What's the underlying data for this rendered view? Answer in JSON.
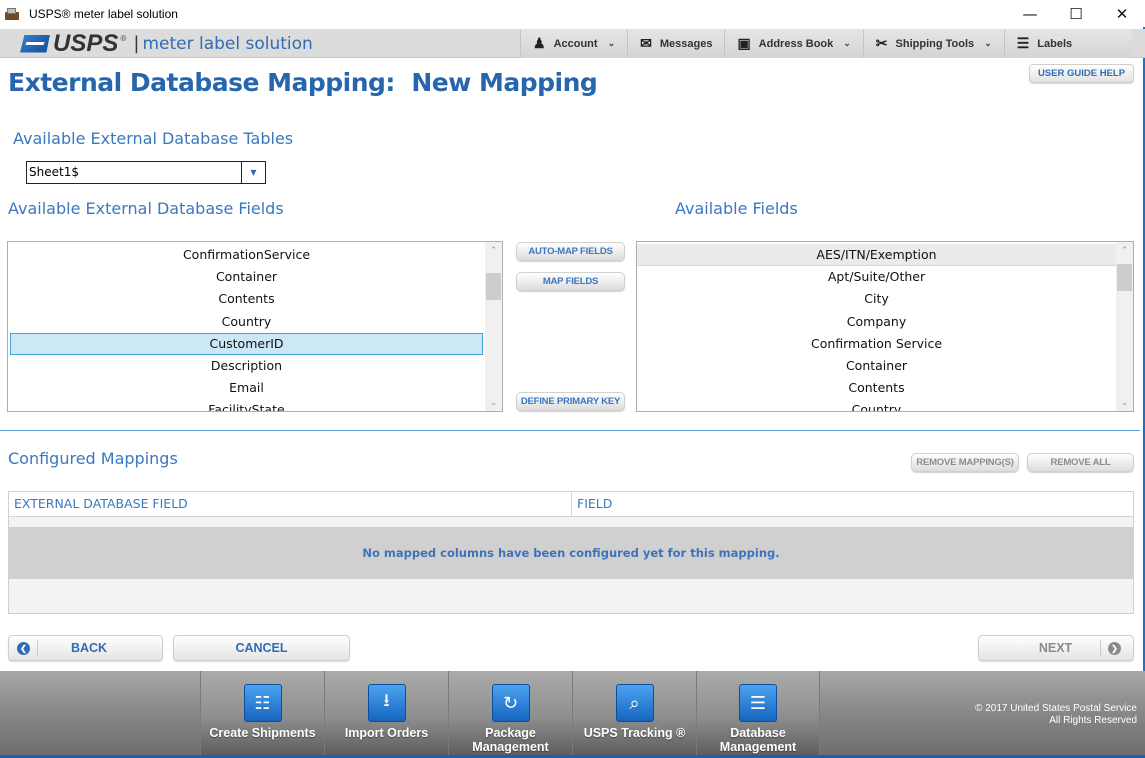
{
  "window": {
    "title": "USPS® meter label solution",
    "controls": {
      "minimize": "—",
      "maximize": "☐",
      "close": "✕"
    }
  },
  "appbar": {
    "brand": "USPS",
    "brand_mark": "®",
    "separator": "|",
    "product": "meter label solution",
    "nav": [
      {
        "label": "Account",
        "icon": "person-icon",
        "glyph": "♟",
        "has_dropdown": true
      },
      {
        "label": "Messages",
        "icon": "envelope-icon",
        "glyph": "✉",
        "has_dropdown": false
      },
      {
        "label": "Address Book",
        "icon": "address-book-icon",
        "glyph": "▣",
        "has_dropdown": true
      },
      {
        "label": "Shipping Tools",
        "icon": "scissors-icon",
        "glyph": "✂",
        "has_dropdown": true
      },
      {
        "label": "Labels",
        "icon": "cart-icon",
        "glyph": "☰",
        "has_dropdown": false
      }
    ],
    "chevron": "⌄"
  },
  "page": {
    "title": "External Database Mapping:  New Mapping",
    "help_button": "USER GUIDE HELP"
  },
  "tables_section": {
    "label": "Available External Database Tables",
    "selected_table": "Sheet1$",
    "dropdown_arrow": "▼"
  },
  "external_fields": {
    "label": "Available External Database Fields",
    "items": [
      "ConfirmationService",
      "Container",
      "Contents",
      "Country",
      "CustomerID",
      "Description",
      "Email",
      "FacilityState"
    ],
    "selected": "CustomerID"
  },
  "available_fields": {
    "label": "Available Fields",
    "items": [
      "AES/ITN/Exemption",
      "Apt/Suite/Other",
      "City",
      "Company",
      "Confirmation Service",
      "Container",
      "Contents",
      "Country"
    ],
    "highlighted": "AES/ITN/Exemption"
  },
  "scroll": {
    "up": "⌃",
    "down": "⌄"
  },
  "actions": {
    "auto_map": "AUTO-MAP FIELDS",
    "map_fields": "MAP FIELDS",
    "define_primary_key": "DEFINE PRIMARY KEY"
  },
  "configured": {
    "label": "Configured Mappings",
    "remove_mappings": "REMOVE MAPPING(S)",
    "remove_all": "REMOVE ALL",
    "columns": [
      "EXTERNAL DATABASE FIELD",
      "FIELD"
    ],
    "empty_message": "No mapped columns have been configured yet for this mapping."
  },
  "navigation": {
    "back": "BACK",
    "cancel": "CANCEL",
    "next": "NEXT",
    "back_glyph": "❮",
    "next_glyph": "❯"
  },
  "footer": {
    "tiles": [
      {
        "label": "Create Shipments",
        "icon": "shipping-label-icon",
        "glyph": "☷"
      },
      {
        "label": "Import Orders",
        "icon": "import-icon",
        "glyph": "⭳"
      },
      {
        "label": "Package\nManagement",
        "icon": "refresh-clock-icon",
        "glyph": "↻"
      },
      {
        "label": "USPS Tracking ®",
        "icon": "tracking-magnifier-icon",
        "glyph": "⌕"
      },
      {
        "label": "Database\nManagement",
        "icon": "database-icon",
        "glyph": "☰"
      }
    ],
    "copyright_line1": "© 2017 United States Postal Service",
    "copyright_line2": "All Rights Reserved"
  },
  "colors": {
    "accent_blue": "#2766ad",
    "label_blue": "#3a78c0",
    "selection_bg": "#cce8f7",
    "selection_border": "#4aa3df",
    "footer_bar": "#1a5fb4"
  }
}
